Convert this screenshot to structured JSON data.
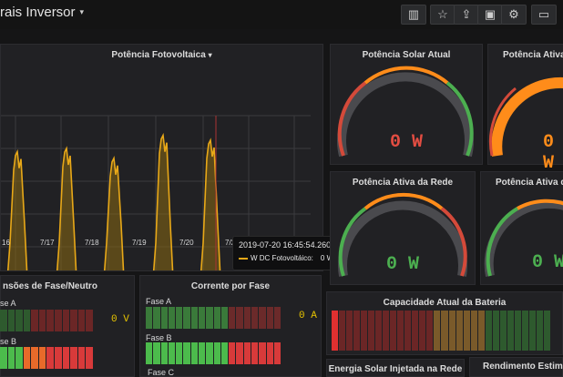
{
  "header": {
    "title": "rais Inversor",
    "title_caret": "▾"
  },
  "toolbar": [
    {
      "name": "add-panel-icon",
      "glyph": "▥"
    },
    {
      "name": "star-icon",
      "glyph": "☆"
    },
    {
      "name": "share-icon",
      "glyph": "⇪"
    },
    {
      "name": "save-icon",
      "glyph": "▣"
    },
    {
      "name": "gear-icon",
      "glyph": "⚙"
    },
    {
      "name": "tv-icon",
      "glyph": "▭"
    }
  ],
  "graph": {
    "title": "Potência Fotovoltaica",
    "title_caret": "▾",
    "x_ticks": [
      "16",
      "7/17",
      "7/18",
      "7/19",
      "7/20",
      "7/2"
    ],
    "tooltip": {
      "time": "2019-07-20 16:45:54.260",
      "series": "W DC Fotovoltáico:",
      "value": "0 W"
    }
  },
  "chart_data": {
    "type": "line",
    "title": "Potência Fotovoltaica",
    "categories": [
      "16",
      "7/17",
      "7/18",
      "7/19",
      "7/20",
      "7/2"
    ],
    "series": [
      {
        "name": "W DC Fotovoltáico"
      }
    ],
    "grid": true
  },
  "gauges": [
    {
      "title": "Potência Solar Atual",
      "value": "0 W"
    },
    {
      "title": "Potência Ativa da",
      "value": "0 W"
    },
    {
      "title": "Potência Ativa da Rede",
      "value": "0 W"
    },
    {
      "title": "Potência Ativa da",
      "value": "0 W"
    }
  ],
  "tensoes": {
    "title": "nsões de Fase/Neutro",
    "phase_a": "se A",
    "phase_b": "se B",
    "value": "0 V"
  },
  "corrente": {
    "title": "Corrente por Fase",
    "phase_a": "Fase A",
    "phase_b": "Fase B",
    "phase_c": "Fase C",
    "value": "0 A"
  },
  "bateria": {
    "title": "Capacidade Atual da Bateria"
  },
  "energia": {
    "title": "Energia Solar Injetada na Rede"
  },
  "rendimento": {
    "title": "Rendimento Estim"
  },
  "colors": {
    "accent": "#e8c400",
    "line": "#e8a818",
    "red": "#d44a3a",
    "green": "#4caf50",
    "orange": "#ff8c1a"
  }
}
